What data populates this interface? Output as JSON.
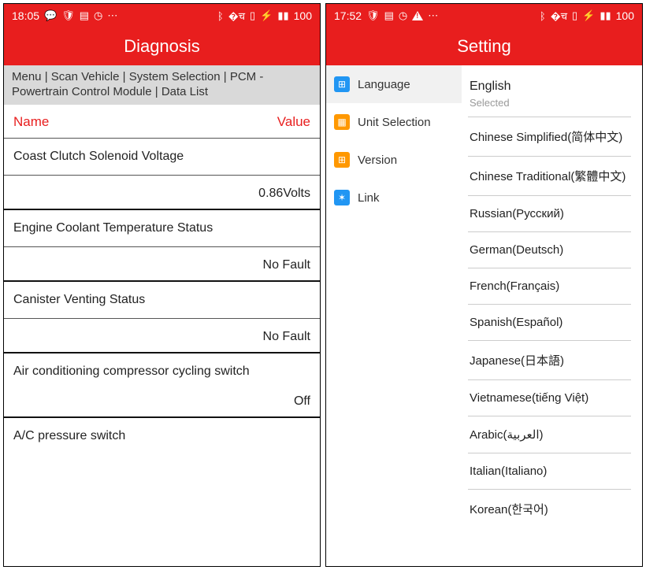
{
  "left": {
    "status": {
      "time": "18:05",
      "battery": "100"
    },
    "header": "Diagnosis",
    "breadcrumb": "Menu | Scan Vehicle | System Selection | PCM - Powertrain Control Module | Data List",
    "col_name": "Name",
    "col_value": "Value",
    "rows": [
      {
        "name": "Coast Clutch Solenoid Voltage",
        "value": "0.86Volts"
      },
      {
        "name": "Engine Coolant Temperature Status",
        "value": "No Fault"
      },
      {
        "name": "Canister Venting Status",
        "value": "No Fault"
      },
      {
        "name": "Air conditioning compressor cycling switch",
        "value": "Off"
      },
      {
        "name": "A/C pressure switch",
        "value": ""
      }
    ]
  },
  "right": {
    "status": {
      "time": "17:52",
      "battery": "100"
    },
    "header": "Setting",
    "sidebar": {
      "items": [
        {
          "label": "Language"
        },
        {
          "label": "Unit Selection"
        },
        {
          "label": "Version"
        },
        {
          "label": "Link"
        }
      ]
    },
    "lang": {
      "current": "English",
      "sub": "Selected",
      "options": [
        "Chinese Simplified(简体中文)",
        "Chinese Traditional(繁體中文)",
        "Russian(Русский)",
        "German(Deutsch)",
        "French(Français)",
        "Spanish(Español)",
        "Japanese(日本語)",
        "Vietnamese(tiếng Việt)",
        "Arabic(العربية)",
        "Italian(Italiano)",
        "Korean(한국어)"
      ]
    }
  }
}
